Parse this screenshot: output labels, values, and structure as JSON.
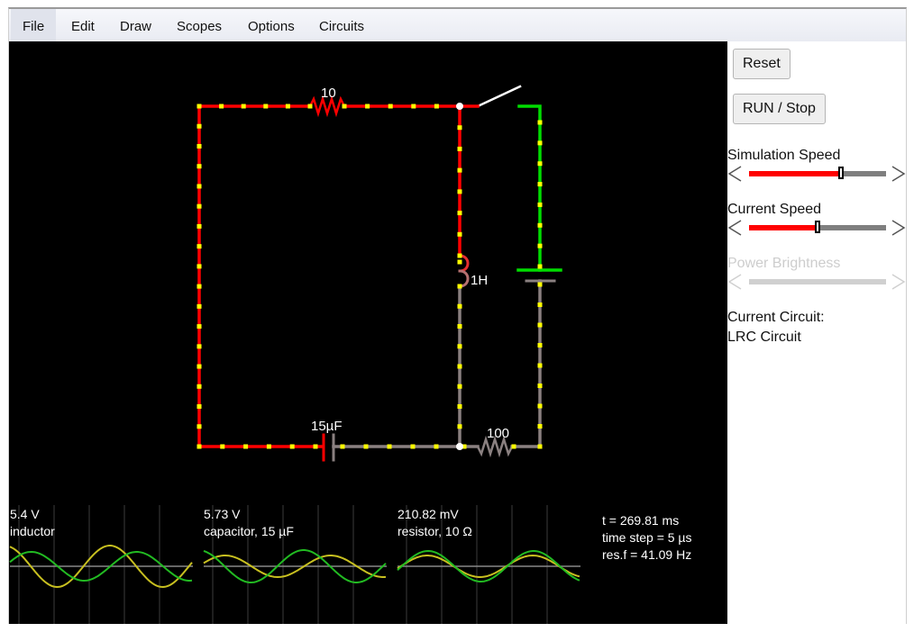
{
  "menu": {
    "items": [
      {
        "label": "File",
        "active": true
      },
      {
        "label": "Edit"
      },
      {
        "label": "Draw"
      },
      {
        "label": "Scopes"
      },
      {
        "label": "Options"
      },
      {
        "label": "Circuits"
      }
    ]
  },
  "sidebar": {
    "reset_label": "Reset",
    "run_stop_label": "RUN / Stop",
    "simulation_speed": {
      "label": "Simulation Speed",
      "value_fraction": 0.67
    },
    "current_speed": {
      "label": "Current Speed",
      "value_fraction": 0.5
    },
    "power_brightness": {
      "label": "Power Brightness",
      "enabled": false
    },
    "current_circuit_label": "Current Circuit:",
    "current_circuit_name": "LRC Circuit"
  },
  "circuit": {
    "resistor_top_label": "10",
    "inductor_label": "1H",
    "capacitor_label": "15µF",
    "resistor_bottom_label": "100",
    "colors": {
      "wire_hot": "#ff0000",
      "wire_positive": "#00dd00",
      "wire_neutral": "#8a8080",
      "current_dot": "#ffff00",
      "switch": "#ffffff",
      "background": "#000000"
    }
  },
  "scopes": [
    {
      "value": "5.4 V",
      "name": "inductor"
    },
    {
      "value": "5.73 V",
      "name": "capacitor, 15 µF"
    },
    {
      "value": "210.82 mV",
      "name": "resistor, 10 Ω"
    }
  ],
  "sim_info": {
    "time": "t = 269.81 ms",
    "time_step": "time step = 5 µs",
    "res_freq": "res.f = 41.09 Hz"
  }
}
